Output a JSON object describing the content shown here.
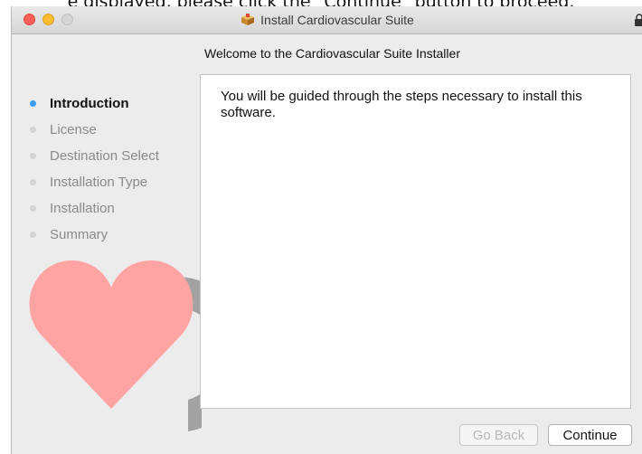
{
  "caption": "e displayed, please click the \"Continue\" button to proceed.",
  "window": {
    "title": "Install Cardiovascular Suite",
    "subtitle": "Welcome to the Cardiovascular Suite  Installer"
  },
  "steps": [
    {
      "label": "Introduction",
      "active": true
    },
    {
      "label": "License",
      "active": false
    },
    {
      "label": "Destination Select",
      "active": false
    },
    {
      "label": "Installation Type",
      "active": false
    },
    {
      "label": "Installation",
      "active": false
    },
    {
      "label": "Summary",
      "active": false
    }
  ],
  "content": {
    "body": "You will be guided through the steps necessary to install this software."
  },
  "buttons": {
    "back": "Go Back",
    "continue": "Continue"
  },
  "colors": {
    "active_dot": "#3c9cf4",
    "heart": "#ffa3a3",
    "close": "#fc5f57",
    "minimize": "#fdbc2e"
  },
  "icons": [
    "package-icon",
    "lock-icon",
    "heart-logo"
  ]
}
